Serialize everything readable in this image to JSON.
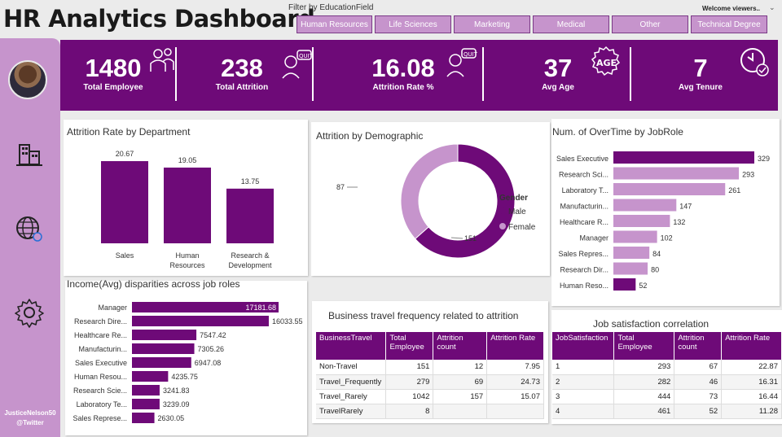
{
  "header": {
    "title": "HR Analytics Dashboard",
    "filter_label": "Filter by EducationField",
    "welcome": "Welcome viewers..",
    "filters": [
      "Human Resources",
      "Life Sciences",
      "Marketing",
      "Medical",
      "Other",
      "Technical Degree"
    ]
  },
  "sidebar": {
    "handle_line1": "JusticeNelson50",
    "handle_line2": "@Twitter",
    "icons": [
      "building-icon",
      "globe-icon",
      "settings-icon"
    ]
  },
  "kpis": [
    {
      "value": "1480",
      "label": "Total Employee",
      "icon": "employees-icon"
    },
    {
      "value": "238",
      "label": "Total Attrition",
      "icon": "quit-person-icon"
    },
    {
      "value": "16.08",
      "label": "Attrition Rate %",
      "icon": "quit-person-icon"
    },
    {
      "value": "37",
      "label": "Avg  Age",
      "icon": "age-icon"
    },
    {
      "value": "7",
      "label": "Avg Tenure",
      "icon": "clock-check-icon"
    }
  ],
  "colors": {
    "accent": "#6e0a78",
    "light": "#c694cc"
  },
  "chart_data": [
    {
      "type": "bar",
      "title": "Attrition Rate by Department",
      "categories": [
        "Sales",
        "Human Resources",
        "Research & Development"
      ],
      "category_lines": [
        [
          "Sales"
        ],
        [
          "Human",
          "Resources"
        ],
        [
          "Research &",
          "Development"
        ]
      ],
      "values": [
        20.67,
        19.05,
        13.75
      ],
      "value_labels": [
        "20.67",
        "19.05",
        "13.75"
      ]
    },
    {
      "type": "pie",
      "title": "Attrition by Demographic",
      "legend_title": "Gender",
      "labels": [
        "Male",
        "Female"
      ],
      "values": [
        151,
        87
      ],
      "value_labels": [
        "151",
        "87"
      ]
    },
    {
      "type": "bar",
      "orientation": "horizontal",
      "title": "Num. of OverTime by JobRole",
      "categories": [
        "Sales Executive",
        "Research Sci...",
        "Laboratory T...",
        "Manufacturin...",
        "Healthcare R...",
        "Manager",
        "Sales Repres...",
        "Research Dir...",
        "Human Reso..."
      ],
      "values": [
        329,
        293,
        261,
        147,
        132,
        102,
        84,
        80,
        52
      ],
      "value_labels": [
        "329",
        "293",
        "261",
        "147",
        "132",
        "102",
        "84",
        "80",
        "52"
      ]
    },
    {
      "type": "bar",
      "orientation": "horizontal",
      "title": "Income(Avg) disparities across job roles",
      "categories": [
        "Manager",
        "Research Dire...",
        "Healthcare Re...",
        "Manufacturin...",
        "Sales Executive",
        "Human Resou...",
        "Research Scie...",
        "Laboratory Te...",
        "Sales Represe..."
      ],
      "values": [
        17181.68,
        16033.55,
        7547.42,
        7305.26,
        6947.08,
        4235.75,
        3241.83,
        3239.09,
        2630.05
      ],
      "value_labels": [
        "17181.68",
        "16033.55",
        "7547.42",
        "7305.26",
        "6947.08",
        "4235.75",
        "3241.83",
        "3239.09",
        "2630.05"
      ]
    },
    {
      "type": "table",
      "title": "Business travel frequency related to attrition",
      "headers": [
        "BusinessTravel",
        "Total Employee",
        "Attrition count",
        "Attrition Rate"
      ],
      "rows": [
        [
          "Non-Travel",
          "151",
          "12",
          "7.95"
        ],
        [
          "Travel_Frequently",
          "279",
          "69",
          "24.73"
        ],
        [
          "Travel_Rarely",
          "1042",
          "157",
          "15.07"
        ],
        [
          "TravelRarely",
          "8",
          "",
          ""
        ]
      ]
    },
    {
      "type": "table",
      "title": "Job satisfaction correlation",
      "headers": [
        "JobSatisfaction",
        "Total Employee",
        "Attrition count",
        "Attrition Rate"
      ],
      "rows": [
        [
          "1",
          "293",
          "67",
          "22.87"
        ],
        [
          "2",
          "282",
          "46",
          "16.31"
        ],
        [
          "3",
          "444",
          "73",
          "16.44"
        ],
        [
          "4",
          "461",
          "52",
          "11.28"
        ]
      ]
    }
  ]
}
